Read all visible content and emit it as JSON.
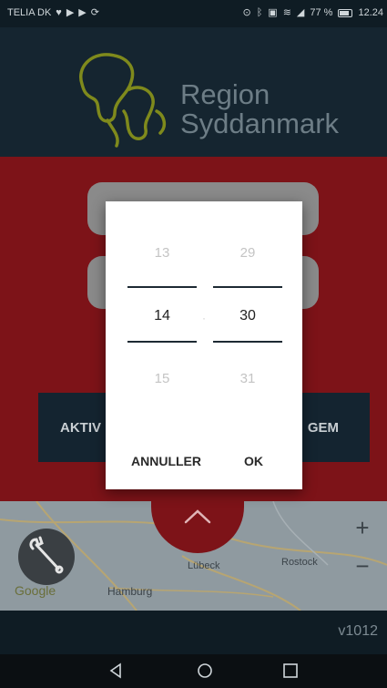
{
  "status_bar": {
    "carrier": "TELIA DK",
    "battery": "77 %",
    "time": "12.24"
  },
  "header": {
    "logo_line1": "Region",
    "logo_line2": "Syddanmark"
  },
  "main": {
    "activate_left": "AKTIV",
    "activate_right": "GEM"
  },
  "map": {
    "place_1": "Lübeck",
    "place_2": "Rostock",
    "place_3": "Hamburg",
    "zoom_in": "+",
    "zoom_out": "−",
    "attribution": "Google"
  },
  "time_picker": {
    "hours": {
      "prev": "13",
      "current": "14",
      "next": "15"
    },
    "minutes": {
      "prev": "29",
      "current": "30",
      "next": "31"
    },
    "cancel_label": "ANNULLER",
    "ok_label": "OK"
  },
  "footer": {
    "version": "v1012"
  },
  "colors": {
    "red_panel": "#7d1318",
    "header_bg": "#152530",
    "logo_green": "#7f8a1c"
  }
}
